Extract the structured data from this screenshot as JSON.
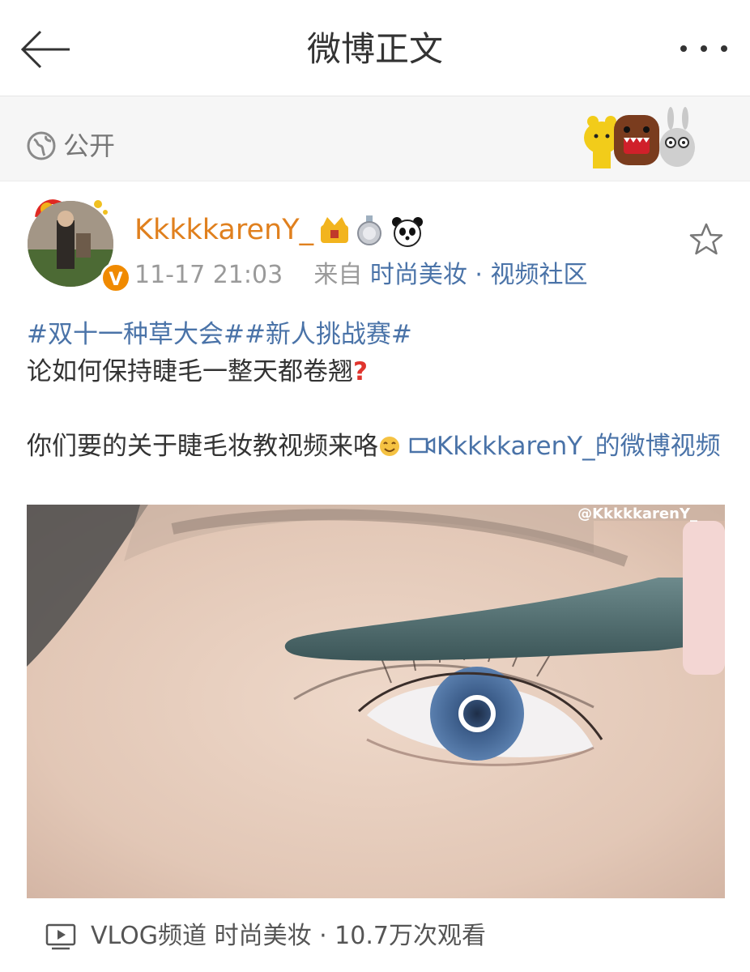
{
  "header": {
    "title": "微博正文"
  },
  "visibility": {
    "label": "公开"
  },
  "post": {
    "username": "KkkkkarenY_",
    "time": "11-17 21:03",
    "source_prefix": "来自",
    "source": "时尚美妆 · 视频社区",
    "topics": "#双十一种草大会##新人挑战赛#",
    "line1": "论如何保持睫毛一整天都卷翘",
    "line2": "你们要的关于睫毛妆教视频来咯",
    "video_link": "KkkkkarenY_的微博视频",
    "watermark": "@KkkkkarenY_"
  },
  "footer": {
    "text": "VLOG频道 时尚美妆 · 10.7万次观看"
  },
  "colors": {
    "link": "#4a73a8",
    "username": "#e0801e",
    "verified": "#f08a00"
  }
}
